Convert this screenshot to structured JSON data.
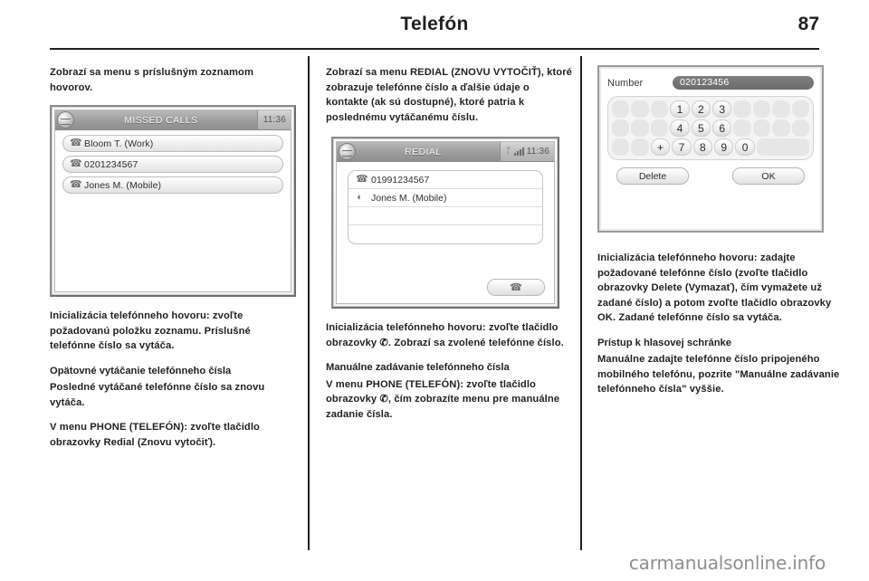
{
  "header": {
    "title": "Telefón",
    "page_number": "87"
  },
  "column1": {
    "intro": "Zobrazí sa menu s príslušným zoznamom hovorov.",
    "figure": {
      "name": "missed-calls-screen",
      "titlebar": "MISSED CALLS",
      "clock": "11:36",
      "rows": [
        {
          "icon": "handset-icon",
          "label": "Bloom T. (Work)"
        },
        {
          "icon": "handset-icon",
          "label": "0201234567"
        },
        {
          "icon": "handset-icon",
          "label": "Jones M. (Mobile)"
        }
      ]
    },
    "para1": "Inicializácia telefónneho hovoru: zvoľte požadovanú položku zoznamu. Príslušné telefónne číslo sa vytáča.",
    "heading1": "Opätovné vytáčanie telefónneho čísla",
    "para2": "Posledné vytáčané telefónne číslo sa znovu vytáča.",
    "para3": "V menu PHONE (TELEFÓN): zvoľte tlačidlo obrazovky Redial (Znovu vytočiť)."
  },
  "column2": {
    "intro": "Zobrazí sa menu REDIAL (ZNOVU VYTOČIŤ), ktoré zobrazuje telefónne číslo a ďalšie údaje o kontakte (ak sú dostupné), ktoré patria k poslednému vytáčanému číslu.",
    "figure": {
      "name": "redial-screen",
      "titlebar": "REDIAL",
      "clock": "11:36",
      "bluetooth_icon": "bluetooth-icon",
      "signal_icon": "signal-strength-icon",
      "rows": [
        {
          "icon": "handset-icon",
          "label": "01991234567"
        },
        {
          "icon": "headset-icon",
          "label": "Jones M. (Mobile)"
        }
      ],
      "call_button_icon": "call-handset-icon"
    },
    "para1": "Inicializácia telefónneho hovoru: zvoľte tlačidlo obrazovky ✆. Zobrazí sa zvolené telefónne číslo.",
    "heading1": "Manuálne zadávanie telefónneho čísla",
    "para2": "V menu PHONE (TELEFÓN): zvoľte tlačidlo obrazovky ✆, čím zobrazíte menu pre manuálne zadanie čísla."
  },
  "column3": {
    "figure": {
      "name": "number-keypad-screen",
      "number_label": "Number",
      "number_value": "020123456",
      "keypad_rows": [
        [
          "",
          "",
          "",
          "1",
          "2",
          "3",
          "",
          "",
          "",
          ""
        ],
        [
          "",
          "",
          "",
          "4",
          "5",
          "6",
          "",
          "",
          "",
          ""
        ],
        [
          "",
          "",
          "+",
          "7",
          "8",
          "9",
          "0",
          "wide"
        ]
      ],
      "delete_label": "Delete",
      "ok_label": "OK"
    },
    "para1": "Inicializácia telefónneho hovoru: zadajte požadované telefónne číslo (zvoľte tlačidlo obrazovky Delete (Vymazať), čím vymažete už zadané číslo) a potom zvoľte tlačidlo obrazovky OK. Zadané telefónne číslo sa vytáča.",
    "heading1": "Prístup k hlasovej schránke",
    "para2": "Manuálne zadajte telefónne číslo pripojeného mobilného telefónu, pozrite \"Manuálne zadávanie telefónneho čísla\" vyššie."
  },
  "watermark": "carmanualsonline.info",
  "colors": {
    "ink": "#231f20",
    "watermark": "#8f8f8f",
    "screen_titlebar": "#9d9d9d",
    "field_fill": "#6b6b6b"
  }
}
